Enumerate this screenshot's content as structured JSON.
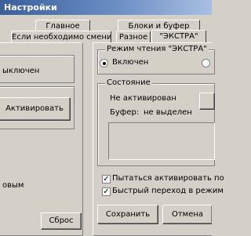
{
  "window": {
    "title": "Настройки"
  },
  "tabs_top": [
    {
      "label": "Главное"
    },
    {
      "label": "Блоки и буфер"
    }
  ],
  "tabs_bottom": [
    {
      "label": "Если необходимо сменить тип"
    },
    {
      "label": "Разное"
    },
    {
      "label": "\"ЭКСТРА\""
    }
  ],
  "left": {
    "item_off": "ыключен",
    "activate_button": "Активировать",
    "item_new": "овым",
    "reset_button": "Сброс"
  },
  "mode_group": {
    "title": "Режим чтения \"ЭКСТРА\"",
    "on_label": "Включен",
    "on_selected": true
  },
  "status_group": {
    "title": "Состояние",
    "status_value": "Не активирован",
    "buffer_label": "Буфер:",
    "buffer_value": "не выделен"
  },
  "options": [
    {
      "label": "Пытаться активировать по",
      "checked": true
    },
    {
      "label": "Быстрый переход в режим",
      "checked": true
    }
  ],
  "buttons": {
    "save": "Сохранить",
    "cancel": "Отмена"
  }
}
